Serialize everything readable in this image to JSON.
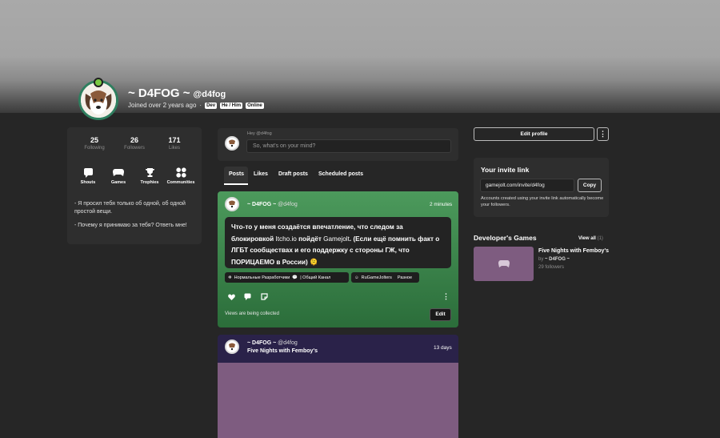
{
  "profile": {
    "display_name": "~ D4FOG ~",
    "handle": "@d4fog",
    "joined": "Joined over 2 years ago",
    "separator": "·",
    "tags": [
      "Dev",
      "He / Him",
      "Online"
    ]
  },
  "stats": [
    {
      "value": "25",
      "label": "Following"
    },
    {
      "value": "26",
      "label": "Followers"
    },
    {
      "value": "171",
      "label": "Likes"
    }
  ],
  "nav": [
    {
      "label": "Shouts",
      "icon": "shouts-icon"
    },
    {
      "label": "Games",
      "icon": "gamepad-icon"
    },
    {
      "label": "Trophies",
      "icon": "trophy-icon"
    },
    {
      "label": "Communities",
      "icon": "communities-icon"
    }
  ],
  "bio": {
    "line1": "- Я просил тебя только об одной, об одной простой вещи.",
    "line2": "- Почему я принимаю за тебя? Ответь мне!"
  },
  "composer": {
    "greeting": "Hey @d4fog",
    "placeholder": "So, what's on your mind?"
  },
  "tabs": [
    "Posts",
    "Likes",
    "Draft posts",
    "Scheduled posts"
  ],
  "post1": {
    "author": "~ D4FOG ~",
    "handle": "@d4fog",
    "time": "2 minutes",
    "text_a": "Что-то у меня создаётся впечатление, что следом за блокировкой ",
    "text_b": "Itcho.io",
    "text_c": " пойдёт ",
    "text_d": "Gamejolt",
    "text_e": ". (Если ещё помнить факт о ЛГБТ сообществах и его поддержку с стороны ГЖ, что ПОРИЦАЕМО в России) 🫠",
    "chips": [
      {
        "community": "Нормальные Разработчики",
        "channel": "| Общий Канал"
      },
      {
        "community": "RuGameJolters",
        "channel": "Разное"
      }
    ],
    "views": "Views are being collected",
    "edit_label": "Edit"
  },
  "post2": {
    "author": "~ D4FOG ~",
    "handle": "@d4fog",
    "title": "Five Nights with Femboy's",
    "time": "13 days"
  },
  "right": {
    "edit_profile": "Edit profile",
    "more": "⋮",
    "invite_title": "Your invite link",
    "invite_link": "gamejolt.com/invite/d4fog",
    "copy": "Copy",
    "invite_desc": "Accounts created using your invite link automatically become your followers.",
    "dev_games_title": "Developer's Games",
    "view_all": "View all",
    "view_all_count": "(1)",
    "game": {
      "title": "Five Nights with Femboy's",
      "by_prefix": "by",
      "by_name": "~ D4FOG ~",
      "followers": "29 followers"
    }
  }
}
